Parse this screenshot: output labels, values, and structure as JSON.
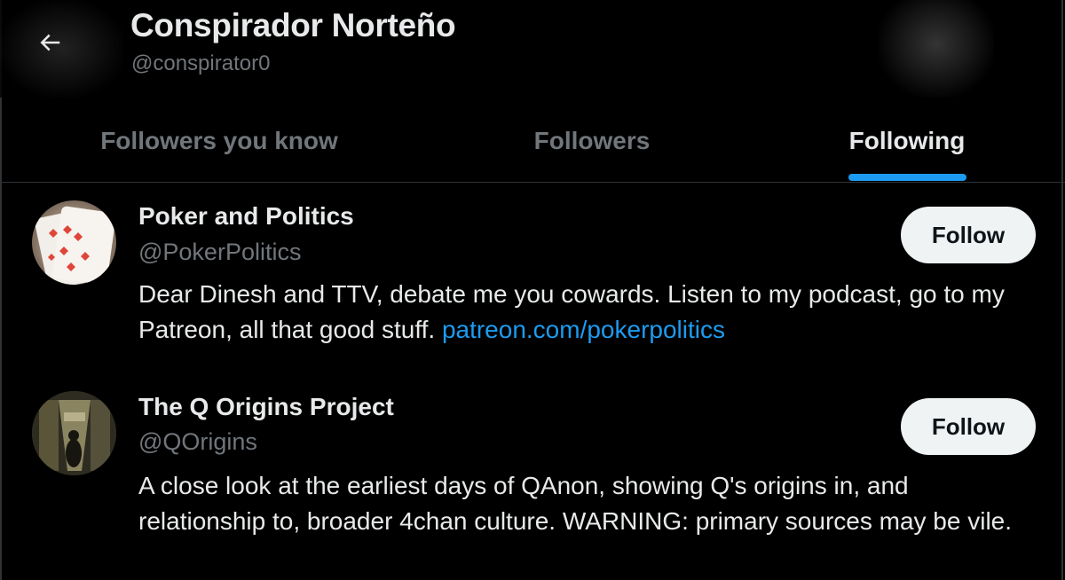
{
  "header": {
    "name": "Conspirador Norteño",
    "handle": "@conspirator0",
    "back_icon": "arrow-left-icon"
  },
  "tabs": [
    {
      "label": "Followers you know",
      "active": false
    },
    {
      "label": "Followers",
      "active": false
    },
    {
      "label": "Following",
      "active": true
    }
  ],
  "users": [
    {
      "name": "Poker and Politics",
      "handle": "@PokerPolitics",
      "bio_text": "Dear Dinesh and TTV, debate me you cowards. Listen to my podcast, go to my Patreon, all that good stuff.",
      "bio_link": "patreon.com/pokerpolitics",
      "button": "Follow"
    },
    {
      "name": "The Q Origins Project",
      "handle": "@QOrigins",
      "bio_text": "A close look at the earliest days of QAnon, showing Q's origins in, and relationship to, broader 4chan culture. WARNING: primary sources may be vile.",
      "button": "Follow"
    }
  ],
  "colors": {
    "background": "#000000",
    "accent": "#1d9bf0",
    "text_primary": "#e7e9ea",
    "text_secondary": "#71767b",
    "button_bg": "#eff3f4"
  }
}
